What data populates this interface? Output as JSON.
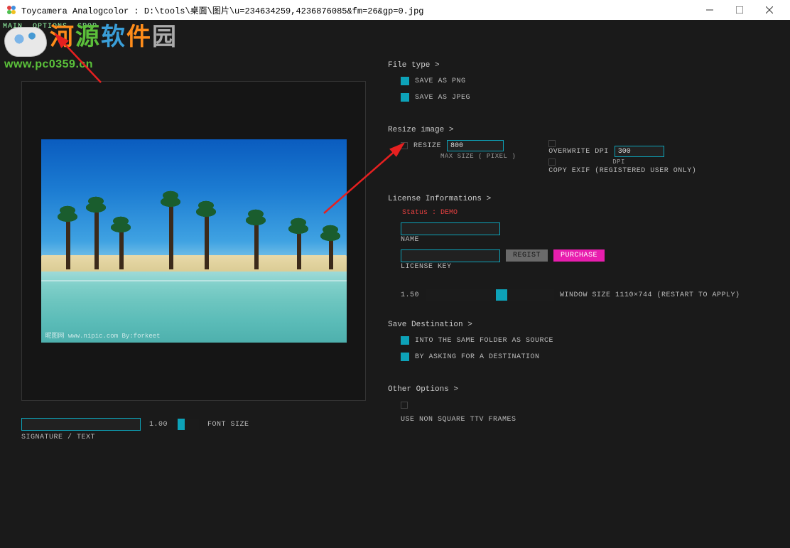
{
  "titlebar": {
    "title": "Toycamera Analogcolor : D:\\tools\\桌面\\图片\\u=234634259,4236876085&fm=26&gp=0.jpg"
  },
  "menu": {
    "main": "MAIN",
    "options": "OPTIONS",
    "crop": "CROP"
  },
  "watermark": {
    "c1": "河",
    "c2": "源",
    "c3": "软",
    "c4": "件",
    "c5": "园",
    "url": "www.pc0359.cn"
  },
  "image_credit": "昵图网  www.nipic.com  By:forkeet",
  "signature": {
    "label": "SIGNATURE / TEXT",
    "font_size_val": "1.00",
    "font_size_label": "FONT SIZE"
  },
  "filetype": {
    "title": "File type >",
    "png": "SAVE AS PNG",
    "jpeg": "SAVE AS JPEG"
  },
  "resize": {
    "title": "Resize image >",
    "resize_label": "RESIZE",
    "max_val": "800",
    "max_hint": "MAX SIZE ( PIXEL )",
    "ow_label": "OVERWRITE DPI",
    "dpi_val": "300",
    "dpi_hint": "DPI",
    "exif": "COPY EXIF (REGISTERED USER ONLY)"
  },
  "license": {
    "title": "License Informations >",
    "status": "Status : DEMO",
    "name_label": "NAME",
    "key_label": "LICENSE KEY",
    "regist_btn": "REGIST",
    "purchase_btn": "PURCHASE",
    "win_val": "1.50",
    "win_label": "WINDOW SIZE 1110×744 (RESTART TO APPLY)"
  },
  "savedest": {
    "title": "Save Destination >",
    "same": "INTO THE SAME FOLDER AS SOURCE",
    "ask": "BY ASKING FOR A DESTINATION"
  },
  "other": {
    "title": "Other Options >",
    "nonsq": "USE NON SQUARE TTV FRAMES"
  }
}
